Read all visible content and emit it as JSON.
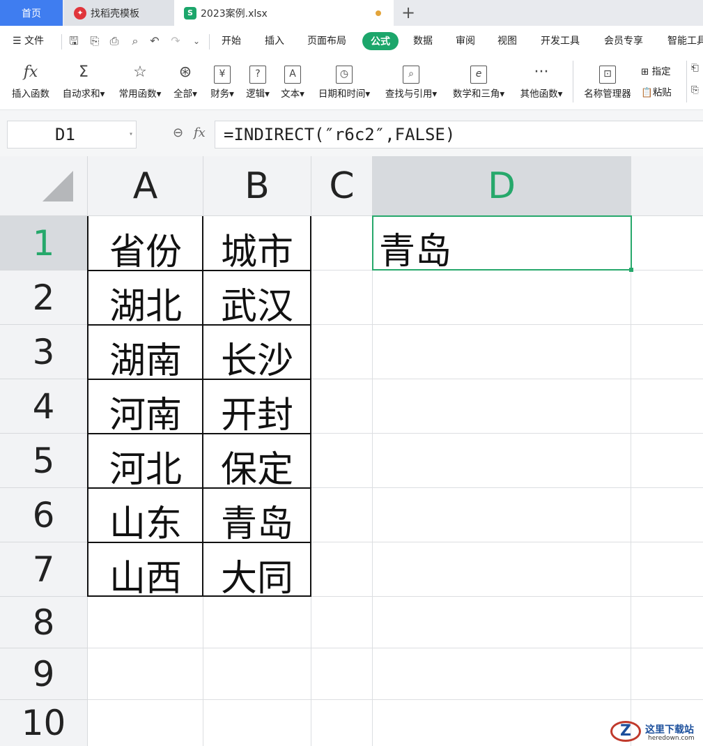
{
  "tabs": {
    "home": "首页",
    "template": "找稻壳模板",
    "file": "2023案例.xlsx",
    "file_icon_letter": "S"
  },
  "menu": {
    "file": "文件",
    "items": [
      "开始",
      "插入",
      "页面布局",
      "公式",
      "数据",
      "审阅",
      "视图",
      "开发工具",
      "会员专享",
      "智能工具"
    ],
    "active": "公式"
  },
  "ribbon": {
    "insert_function": "插入函数",
    "autosum": "自动求和",
    "common_functions": "常用函数",
    "all": "全部",
    "finance": "财务",
    "logic": "逻辑",
    "text": "文本",
    "datetime": "日期和时间",
    "lookup": "查找与引用",
    "math": "数学和三角",
    "other": "其他函数",
    "name_manager": "名称管理器",
    "specify": "指定",
    "paste": "粘贴"
  },
  "formula_bar": {
    "cell_ref": "D1",
    "fx_label": "fx",
    "formula": "=INDIRECT(″r6c2″,FALSE)"
  },
  "grid": {
    "columns": [
      "A",
      "B",
      "C",
      "D"
    ],
    "selected_column": "D",
    "rows": [
      "1",
      "2",
      "3",
      "4",
      "5",
      "6",
      "7",
      "8",
      "9",
      "10"
    ],
    "selected_row": "1",
    "table": [
      [
        "省份",
        "城市"
      ],
      [
        "湖北",
        "武汉"
      ],
      [
        "湖南",
        "长沙"
      ],
      [
        "河南",
        "开封"
      ],
      [
        "河北",
        "保定"
      ],
      [
        "山东",
        "青岛"
      ],
      [
        "山西",
        "大同"
      ]
    ],
    "d1_value": "青岛"
  },
  "watermark": {
    "title": "这里下载站",
    "url": "heredown.com"
  },
  "colors": {
    "accent_green": "#26a86b",
    "home_tab_blue": "#3f7df0"
  }
}
